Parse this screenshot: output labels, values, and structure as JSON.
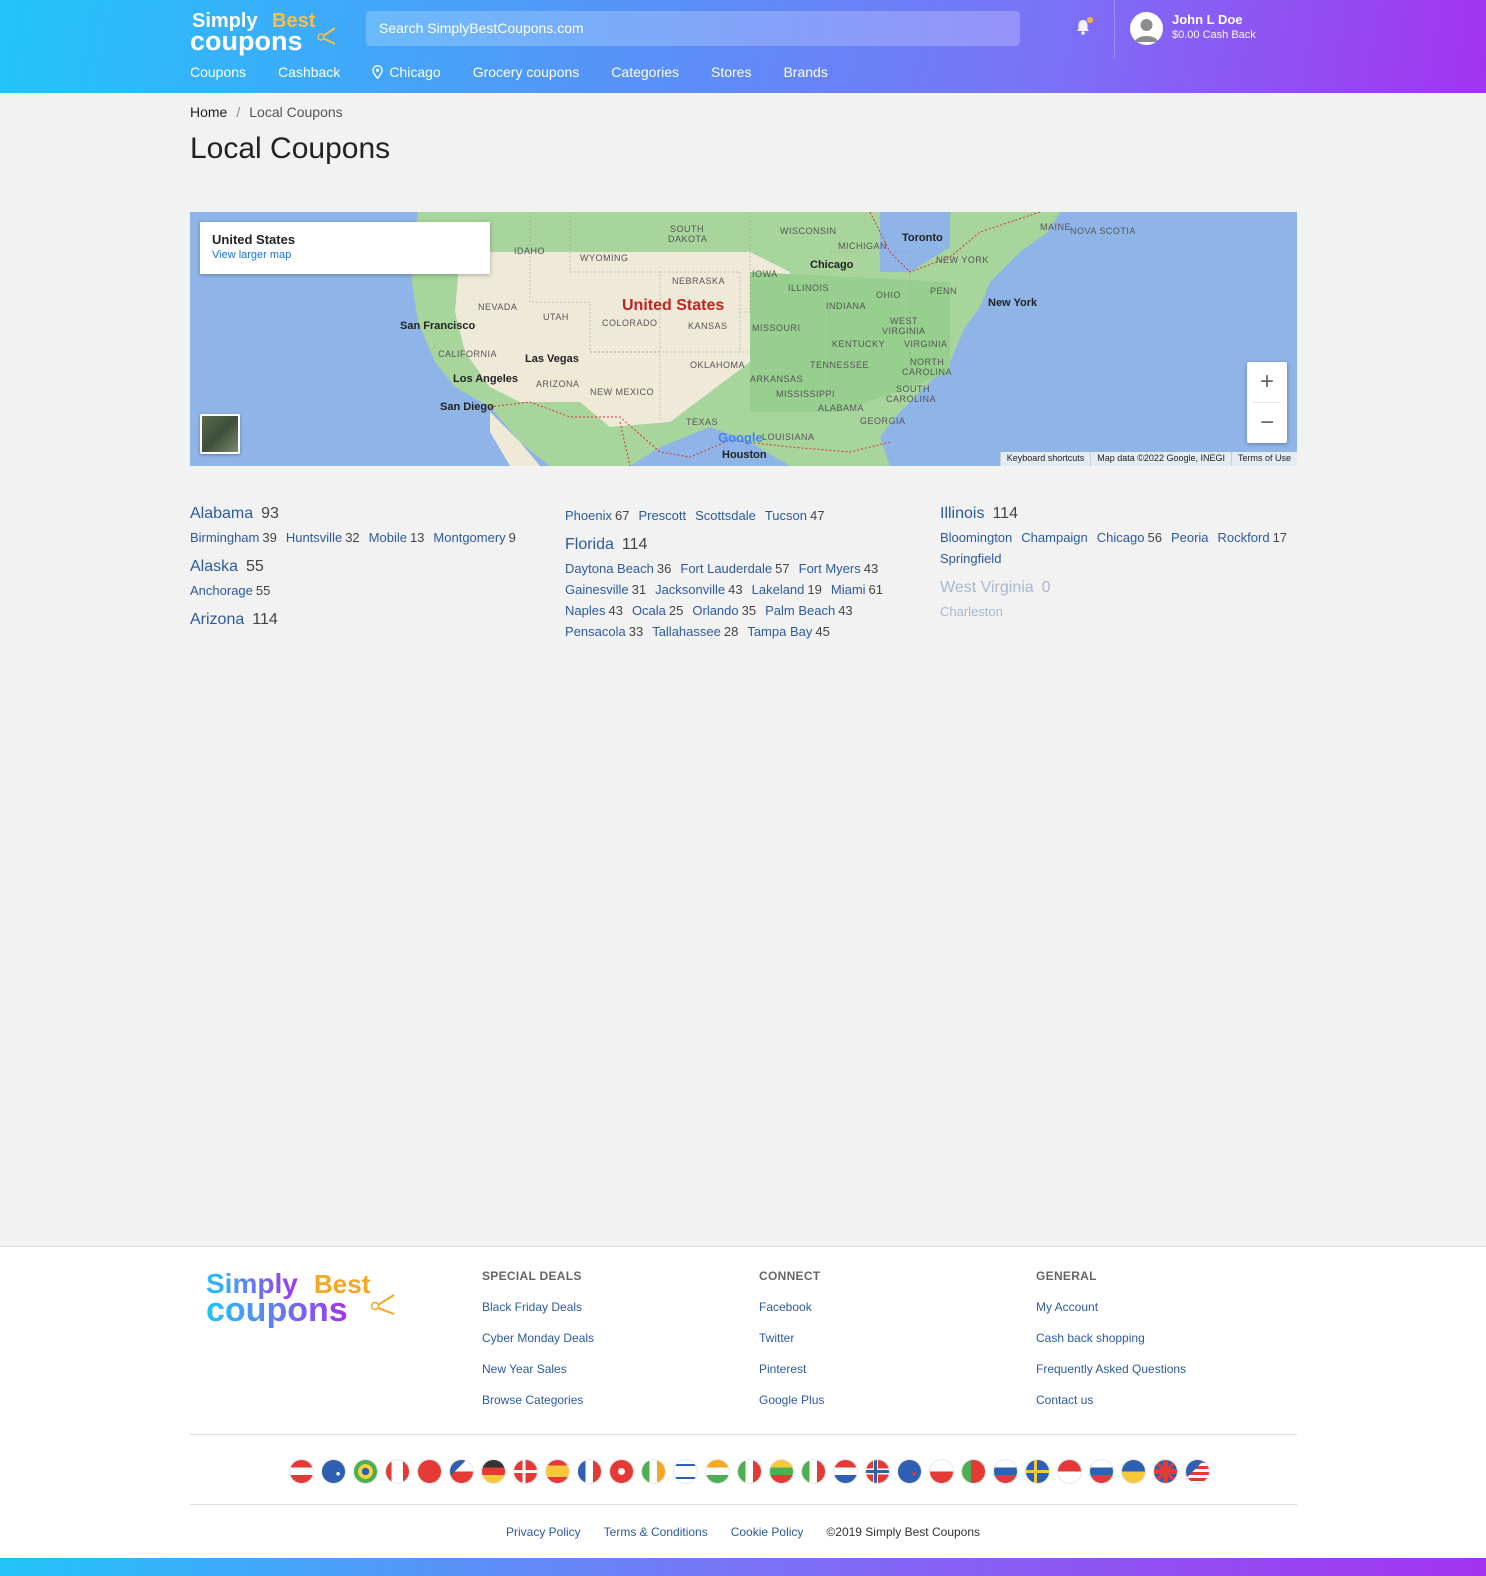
{
  "header": {
    "logo_alt": "Simply Best coupons",
    "search_placeholder": "Search SimplyBestCoupons.com",
    "user": {
      "name": "John L Doe",
      "cash": "$0.00 Cash Back"
    },
    "nav": [
      {
        "label": "Coupons",
        "icon": ""
      },
      {
        "label": "Cashback",
        "icon": ""
      },
      {
        "label": "Chicago",
        "icon": "map-pin-icon"
      },
      {
        "label": "Grocery coupons",
        "icon": ""
      },
      {
        "label": "Categories",
        "icon": ""
      },
      {
        "label": "Stores",
        "icon": ""
      },
      {
        "label": "Brands",
        "icon": ""
      }
    ]
  },
  "breadcrumb": {
    "home": "Home",
    "separator": "/",
    "current": "Local Coupons"
  },
  "page_title": "Local Coupons",
  "map": {
    "info_title": "United States",
    "info_link": "View larger map",
    "country_label": "United States",
    "zoom_in": "+",
    "zoom_out": "−",
    "attribution": [
      "Keyboard shortcuts",
      "Map data ©2022 Google, INEGI",
      "Terms of Use"
    ],
    "google": "Google"
  },
  "locations": {
    "col1": [
      {
        "state": "Alabama",
        "count": "93",
        "cities": [
          [
            "Birmingham",
            "39"
          ],
          [
            "Huntsville",
            "32"
          ],
          [
            "Mobile",
            "13"
          ],
          [
            "Montgomery",
            "9"
          ]
        ]
      },
      {
        "state": "Alaska",
        "count": "55",
        "cities": [
          [
            "Anchorage",
            "55"
          ]
        ]
      },
      {
        "state": "Arizona",
        "count": "114",
        "cities": []
      }
    ],
    "col2_cont": [
      [
        "Phoenix",
        "67"
      ],
      [
        "Prescott",
        ""
      ],
      [
        "Scottsdale",
        ""
      ],
      [
        "Tucson",
        "47"
      ]
    ],
    "col2": [
      {
        "state": "Florida",
        "count": "114",
        "cities": [
          [
            "Daytona Beach",
            "36"
          ],
          [
            "Fort Lauderdale",
            "57"
          ],
          [
            "Fort Myers",
            "43"
          ],
          [
            "Gainesville",
            "31"
          ],
          [
            "Jacksonville",
            "43"
          ],
          [
            "Lakeland",
            "19"
          ],
          [
            "Miami",
            "61"
          ],
          [
            "Naples",
            "43"
          ],
          [
            "Ocala",
            "25"
          ],
          [
            "Orlando",
            "35"
          ],
          [
            "Palm Beach",
            "43"
          ],
          [
            "Pensacola",
            "33"
          ],
          [
            "Tallahassee",
            "28"
          ],
          [
            "Tampa Bay",
            "45"
          ]
        ]
      }
    ],
    "col3": [
      {
        "state": "Illinois",
        "count": "114",
        "cities": [
          [
            "Bloomington",
            ""
          ],
          [
            "Champaign",
            ""
          ],
          [
            "Chicago",
            "56"
          ],
          [
            "Peoria",
            ""
          ],
          [
            "Rockford",
            "17"
          ],
          [
            "Springfield",
            ""
          ]
        ]
      },
      {
        "state": "West Virginia",
        "count": "0",
        "cities": [
          [
            "Charleston",
            ""
          ]
        ],
        "disabled": true
      }
    ]
  },
  "footer": {
    "columns": [
      {
        "heading": "SPECIAL DEALS",
        "links": [
          "Black Friday Deals",
          "Cyber Monday Deals",
          "New Year Sales",
          "Browse Categories"
        ]
      },
      {
        "heading": "CONNECT",
        "links": [
          "Facebook",
          "Twitter",
          "Pinterest",
          "Google Plus"
        ]
      },
      {
        "heading": "GENERAL",
        "links": [
          "My Account",
          "Cash back shopping",
          "Frequently Asked Questions",
          "Contact us"
        ]
      }
    ],
    "flags": [
      "austria",
      "australia",
      "brazil",
      "canada",
      "switzerland",
      "czech-republic",
      "germany",
      "denmark",
      "spain",
      "france",
      "hong-kong",
      "ireland",
      "israel",
      "india",
      "italy",
      "lithuania",
      "mexico",
      "netherlands",
      "norway",
      "new-zealand",
      "poland",
      "portugal",
      "russia",
      "sweden",
      "singapore",
      "slovakia",
      "ukraine",
      "united-kingdom",
      "united-states"
    ],
    "bottom_links": [
      "Privacy Policy",
      "Terms & Conditions",
      "Cookie Policy"
    ],
    "copyright": "©2019 Simply Best Coupons"
  },
  "colors": {
    "link": "#2c5aa0",
    "gradient_start": "#22c4fb",
    "gradient_end": "#a333f0",
    "logo_orange": "#f5a623"
  }
}
